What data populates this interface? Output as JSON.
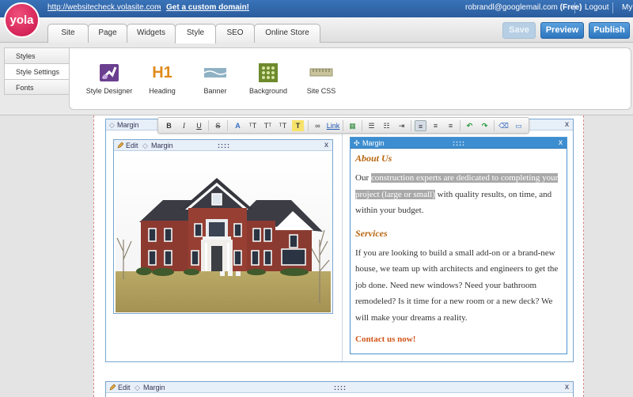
{
  "topbar": {
    "site_url": "http://websitecheck.volasite.com",
    "separator": "-",
    "custom_domain_link": "Get a custom domain!",
    "email": "robrandl@googlemail.com",
    "plan": "(Free)",
    "logout": "Logout",
    "my": "My"
  },
  "logo": {
    "text": "yola"
  },
  "tabs": [
    {
      "label": "Site"
    },
    {
      "label": "Page"
    },
    {
      "label": "Widgets"
    },
    {
      "label": "Style",
      "active": true
    },
    {
      "label": "SEO"
    },
    {
      "label": "Online Store"
    }
  ],
  "actions": {
    "save": "Save",
    "preview": "Preview",
    "publish": "Publish"
  },
  "style_nav": [
    {
      "label": "Styles"
    },
    {
      "label": "Style Settings",
      "active": true
    },
    {
      "label": "Fonts"
    }
  ],
  "style_tools": [
    {
      "label": "Style Designer",
      "icon": "style-designer-icon"
    },
    {
      "label": "Heading",
      "icon": "heading-icon",
      "icon_text": "H1"
    },
    {
      "label": "Banner",
      "icon": "banner-icon"
    },
    {
      "label": "Background",
      "icon": "background-icon"
    },
    {
      "label": "Site CSS",
      "icon": "site-css-icon"
    }
  ],
  "toolbar": {
    "link_label": "Link"
  },
  "blocks": {
    "outer_top": {
      "margin_label": "Margin",
      "close": "x"
    },
    "image_block": {
      "edit_label": "Edit",
      "margin_label": "Margin",
      "grip": "::::",
      "close": "x"
    },
    "text_block": {
      "margin_label": "Margin",
      "grip": "::::",
      "close": "x"
    },
    "outer_bottom": {
      "edit_label": "Edit",
      "margin_label": "Margin",
      "grip": "::::",
      "close": "x"
    }
  },
  "content": {
    "about_heading": "About Us",
    "about_pre": "Our ",
    "about_highlight": "construction experts are dedicated to completing your project (large or small)",
    "about_post": " with quality results, on time, and within your budget.",
    "services_heading": "Services",
    "services_text": "If you are looking to build a small add-on or a brand-new house, we team up with architects and engineers to get the job done. Need new windows? Need your bathroom remodeled? Is it time for a new room or a new deck? We will make your dreams a reality.",
    "cta": "Contact us now!"
  },
  "colors": {
    "topbar": "#2f65a8",
    "primary_button": "#3a82c8",
    "heading": "#b8670f",
    "cta": "#d2561a",
    "selection": "#a9a9a9"
  }
}
